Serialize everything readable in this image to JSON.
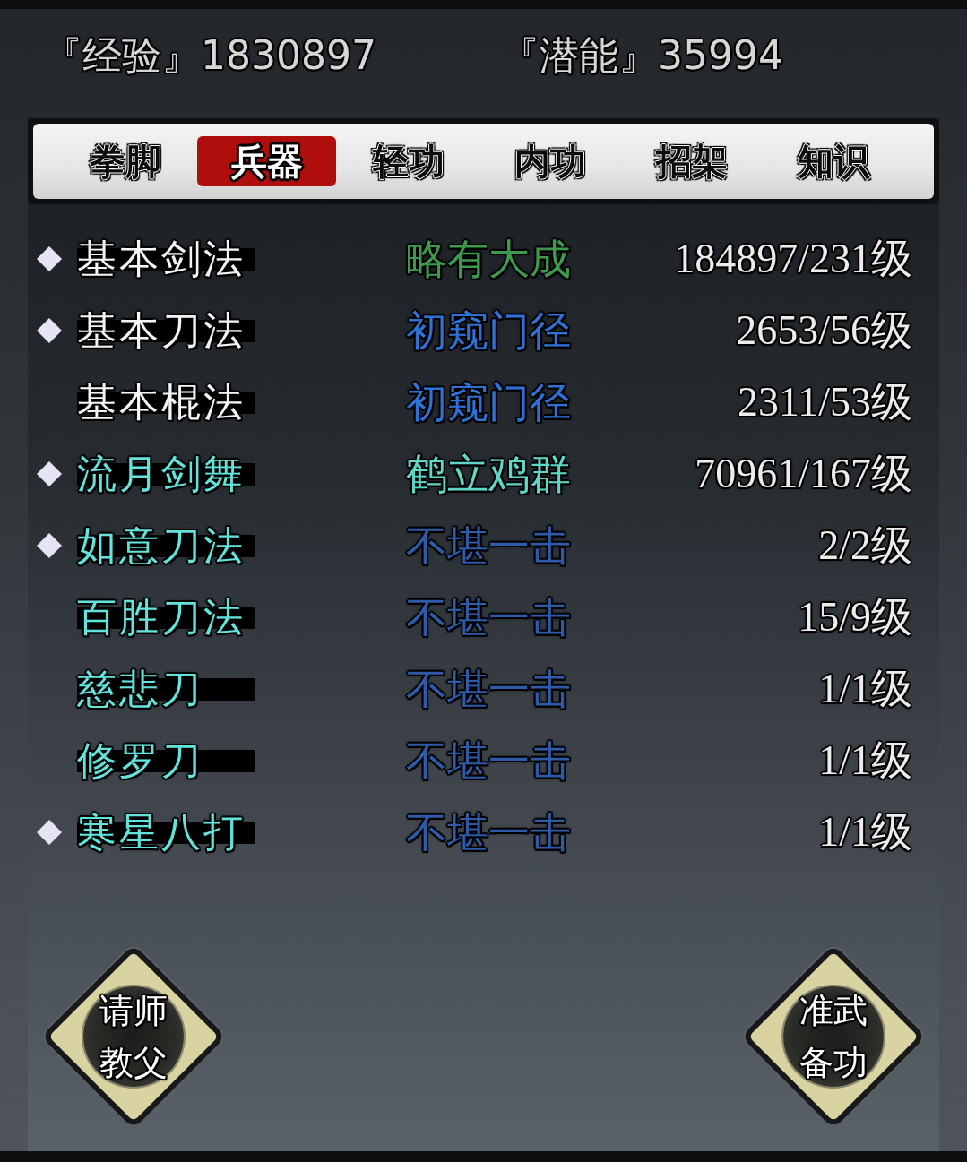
{
  "header": {
    "stats": [
      "『经验』1830897",
      "『潜能』35994"
    ]
  },
  "tabs": [
    {
      "label": "拳脚",
      "selected": false
    },
    {
      "label": "兵器",
      "selected": true
    },
    {
      "label": "轻功",
      "selected": false
    },
    {
      "label": "内功",
      "selected": false
    },
    {
      "label": "招架",
      "selected": false
    },
    {
      "label": "知识",
      "selected": false
    }
  ],
  "skills": [
    {
      "equipped": true,
      "name": {
        "text": "基本剑法",
        "color": "#f4f4f4"
      },
      "rank": {
        "text": "略有大成",
        "color": "#3f9a4e"
      },
      "progress": "184897/231级"
    },
    {
      "equipped": true,
      "name": {
        "text": "基本刀法",
        "color": "#f4f4f4"
      },
      "rank": {
        "text": "初窥门径",
        "color": "#2f72d6"
      },
      "progress": "2653/56级"
    },
    {
      "equipped": false,
      "name": {
        "text": "基本棍法",
        "color": "#f4f4f4"
      },
      "rank": {
        "text": "初窥门径",
        "color": "#2f72d6"
      },
      "progress": "2311/53级"
    },
    {
      "equipped": true,
      "name": {
        "text": "流月剑舞",
        "color": "#62e4dc"
      },
      "rank": {
        "text": "鹤立鸡群",
        "color": "#5ed6c8"
      },
      "progress": "70961/167级"
    },
    {
      "equipped": true,
      "name": {
        "text": "如意刀法",
        "color": "#62e4dc"
      },
      "rank": {
        "text": "不堪一击",
        "color": "#2f5aa8"
      },
      "progress": "2/2级"
    },
    {
      "equipped": false,
      "name": {
        "text": "百胜刀法",
        "color": "#62e4dc"
      },
      "rank": {
        "text": "不堪一击",
        "color": "#2f5aa8"
      },
      "progress": "15/9级"
    },
    {
      "equipped": false,
      "name": {
        "text": "慈悲刀",
        "color": "#62e4dc"
      },
      "rank": {
        "text": "不堪一击",
        "color": "#2f5aa8"
      },
      "progress": "1/1级"
    },
    {
      "equipped": false,
      "name": {
        "text": "修罗刀",
        "color": "#62e4dc"
      },
      "rank": {
        "text": "不堪一击",
        "color": "#2f5aa8"
      },
      "progress": "1/1级"
    },
    {
      "equipped": true,
      "name": {
        "text": "寒星八打",
        "color": "#62e4dc"
      },
      "rank": {
        "text": "不堪一击",
        "color": "#2f5aa8"
      },
      "progress": "1/1级"
    }
  ],
  "actions": [
    "请师教父",
    "准武备功"
  ]
}
